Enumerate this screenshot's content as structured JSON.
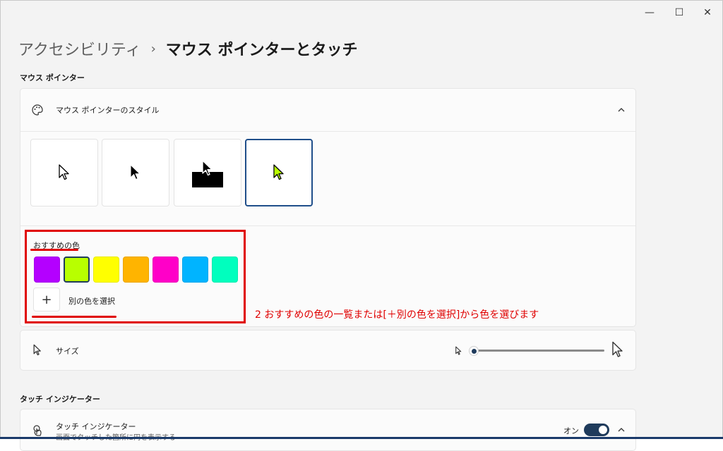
{
  "window": {
    "minimize_glyph": "—",
    "maximize_glyph": "☐",
    "close_glyph": "✕"
  },
  "breadcrumb": {
    "parent": "アクセシビリティ",
    "separator": "›",
    "current": "マウス ポインターとタッチ"
  },
  "mouse_pointer_section": {
    "heading": "マウス ポインター",
    "style_row_label": "マウス ポインターのスタイル",
    "pointer_styles": [
      {
        "name": "white"
      },
      {
        "name": "black"
      },
      {
        "name": "inverted"
      },
      {
        "name": "custom",
        "selected": true
      }
    ],
    "recommended_colors_label": "おすすめの色",
    "recommended_colors": [
      "#b400ff",
      "#b8ff00",
      "#ffff00",
      "#ffb400",
      "#ff00c8",
      "#00b4ff",
      "#00ffbe"
    ],
    "selected_color_index": 1,
    "add_color_glyph": "+",
    "add_color_label": "別の色を選択",
    "size_row_label": "サイズ",
    "size_value": 0.0
  },
  "annotation": "2 おすすめの色の一覧または[＋別の色を選択]から色を選びます",
  "touch_section": {
    "heading": "タッチ インジケーター",
    "row_label": "タッチ インジケーター",
    "row_sublabel": "画面でタッチした箇所に円を表示する",
    "toggle_label": "オン",
    "toggle_on": true
  },
  "colors": {
    "accent": "#1f3b5c",
    "annotation_red": "#e00000",
    "selected_pointer_fill": "#b8ff00"
  }
}
